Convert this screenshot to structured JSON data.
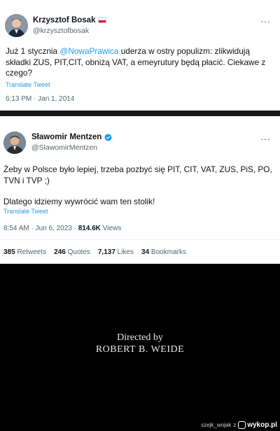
{
  "tweet1": {
    "name": "Krzysztof Bosak",
    "handle": "@krzysztofbosak",
    "text_before": "Już 1 stycznia ",
    "mention": "@NowaPrawica",
    "text_after": " uderza w ostry populizm: zlikwidują składki ZUS, PIT,CIT, obniżą VAT, a emeyrutury będą płacić. Ciekawe z czego?",
    "translate": "Translate Tweet",
    "timestamp": "6:13 PM · Jan 1, 2014",
    "more": "···",
    "flag_icon": "poland-flag-icon"
  },
  "tweet2": {
    "name": "Sławomir Mentzen",
    "handle": "@SlawomirMentzen",
    "text1": "Żeby w Polsce było lepiej, trzeba pozbyć się PIT, CIT, VAT, ZUS, PiS, PO, TVN i TVP ;)",
    "text2": "Dlatego idziemy wywrócić wam ten stolik!",
    "translate": "Translate Tweet",
    "timestamp": "8:54 AM · Jun 6, 2023 · ",
    "views_count": "814.6K",
    "views_label": " Views",
    "more": "···",
    "verified_color": "#1d9bf0",
    "stats": {
      "retweets_count": "385",
      "retweets_label": " Retweets",
      "quotes_count": "246",
      "quotes_label": " Quotes",
      "likes_count": "7,137",
      "likes_label": " Likes",
      "bookmarks_count": "34",
      "bookmarks_label": " Bookmarks"
    }
  },
  "film": {
    "credit_line1": "Directed by",
    "credit_line2": "ROBERT B. WEIDE"
  },
  "watermark": {
    "user": "szejk_wojak",
    "sep": "z",
    "brand": "wykop.pl"
  },
  "colors": {
    "link": "#1d9bf0",
    "secondary": "#536471",
    "text": "#0f1419"
  }
}
